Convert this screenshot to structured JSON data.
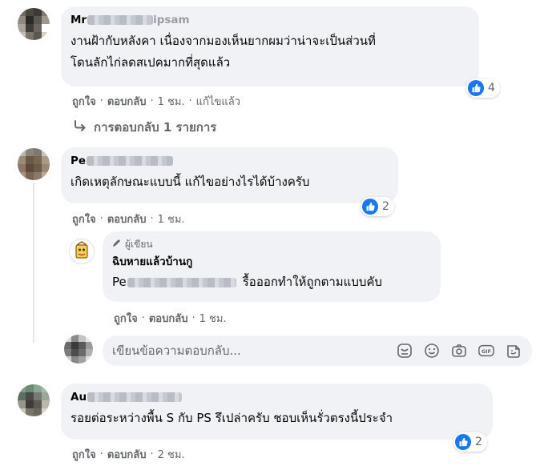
{
  "comments": [
    {
      "author_visible": "Mr",
      "author_tail": "ipsam",
      "text_line1": "งานฝ้ากับหลังคา เนื่องจากมองเห็นยากผมว่าน่าจะเป็นส่วนที่",
      "text_line2": "โดนลักไก่ลดสเปคมากที่สุดแล้ว",
      "reaction_count": "4",
      "like": "ถูกใจ",
      "reply": "ตอบกลับ",
      "time": "1 ชม.",
      "edited": "แก้ไขแล้ว",
      "replies_label": "การตอบกลับ 1 รายการ"
    },
    {
      "author_visible": "Pe",
      "text": "เกิดเหตุลักษณะแบบนี้ แก้ไขอย่างไรได้บ้างครับ",
      "reaction_count": "2",
      "like": "ถูกใจ",
      "reply": "ตอบกลับ",
      "time": "1 ชม."
    },
    {
      "badge": "ผู้เขียน",
      "author": "ฉิบหายแล้วบ้านกู",
      "tag_visible": "Pe",
      "text": "รื้อออกทำให้ถูกตามแบบคับ",
      "like": "ถูกใจ",
      "reply": "ตอบกลับ",
      "time": "1 ชม."
    },
    {
      "author_visible": "Au",
      "text": "รอยต่อระหว่างพื้น S กับ PS รึเปล่าครับ ชอบเห็นรั่วตรงนี้ประจำ",
      "reaction_count": "2",
      "like": "ถูกใจ",
      "reply": "ตอบกลับ",
      "time": "2 ชม."
    }
  ],
  "reply_box": {
    "placeholder": "เขียนข้อความตอบกลับ..."
  },
  "colors": {
    "like_blue": "#1877f2",
    "bubble_bg": "#f0f2f5",
    "meta_gray": "#65676b"
  },
  "icons": [
    "like-icon",
    "reply-arrow-icon",
    "pencil-icon",
    "sticker-icon",
    "emoji-icon",
    "camera-icon",
    "gif-icon",
    "sticker-fold-icon"
  ]
}
